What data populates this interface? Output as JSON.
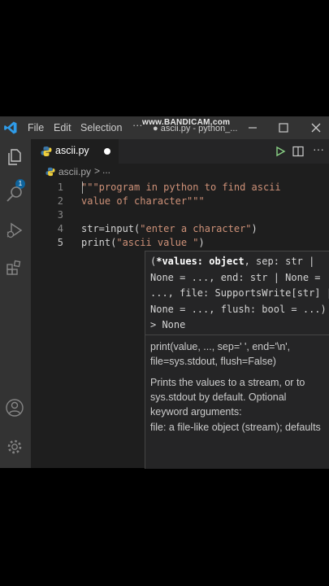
{
  "watermark": "www.BANDICAM.com",
  "titlebar": {
    "title": "● ascii.py - python_...",
    "menu": [
      {
        "label": "File"
      },
      {
        "label": "Edit"
      },
      {
        "label": "Selection"
      },
      {
        "label": "···"
      }
    ]
  },
  "activity": {
    "source_control_badge": "1"
  },
  "tab": {
    "label": "ascii.py"
  },
  "breadcrumb": {
    "file": "ascii.py",
    "separator": ">",
    "more": "..."
  },
  "editor": {
    "line_numbers": [
      "1",
      "2",
      "3",
      "4",
      "5"
    ],
    "lines": {
      "l1": "\"\"\"program in python to find ascii",
      "l2": "value of character\"\"\"",
      "l4_a": "str=input(",
      "l4_b": "\"enter a character\"",
      "l4_c": ")",
      "l5_a": "print(",
      "l5_b": "\"ascii value \"",
      "l5_c": ")"
    }
  },
  "hover": {
    "signature": {
      "open": "(",
      "param_bold": "*values: object",
      "line1_rest": ", sep: str |",
      "line2": "None = ..., end: str | None =",
      "line3": "..., file: SupportsWrite[str] |",
      "line4": "None = ..., flush: bool = ...) -",
      "line5": "> None"
    },
    "doc": {
      "line1": "print(value, ..., sep=' ', end='\\n',",
      "line2": "file=sys.stdout, flush=False)",
      "line3": "Prints the values to a stream, or to",
      "line4": "sys.stdout by default. Optional",
      "line5": "keyword arguments:",
      "line6": "file: a file-like object (stream); defaults"
    }
  },
  "colors": {
    "editor_bg": "#1e1e1e",
    "chrome_bg": "#333333",
    "string": "#ce9178",
    "text": "#d4d4d4",
    "accent": "#0e639c",
    "run_green": "#89d185"
  }
}
